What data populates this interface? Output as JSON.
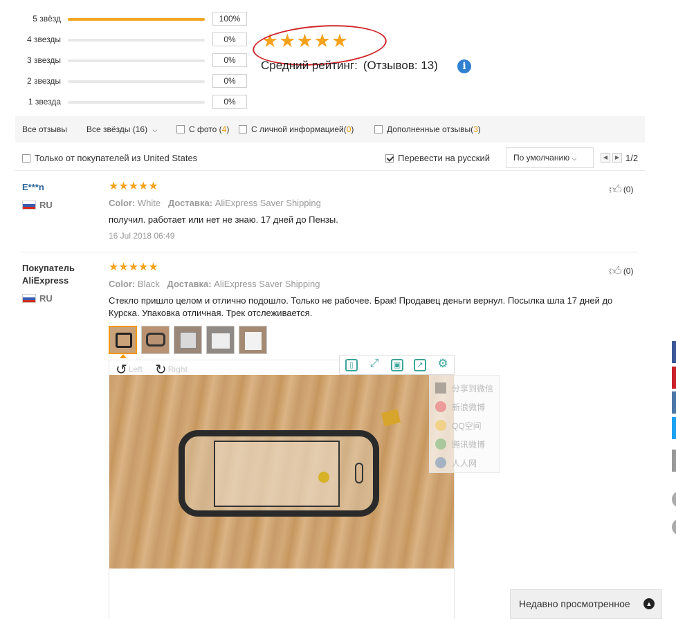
{
  "histogram": [
    {
      "label": "5 звёзд",
      "percent": "100%",
      "fill": 1.0
    },
    {
      "label": "4 звезды",
      "percent": "0%",
      "fill": 0
    },
    {
      "label": "3 звезды",
      "percent": "0%",
      "fill": 0
    },
    {
      "label": "2 звезды",
      "percent": "0%",
      "fill": 0
    },
    {
      "label": "1 звезда",
      "percent": "0%",
      "fill": 0
    }
  ],
  "summary": {
    "stars": "★★★★★",
    "avg_label": "Средний рейтинг:",
    "count_label": "(Отзывов: 13)",
    "info": "i"
  },
  "filters": {
    "all": "Все отзывы",
    "all_stars": "Все звёзды (16)",
    "with_photo": "С фото (",
    "with_photo_count": "4",
    "with_photo_close": ")",
    "with_info": "С личной информацией(",
    "with_info_count": "0",
    "with_info_close": ")",
    "supplemented": "Дополненные отзывы(",
    "supplemented_count": "3",
    "supplemented_close": ")",
    "only_from": "Только от покупателей из United States",
    "translate": "Перевести на русский",
    "sort": "По умолчанию",
    "page": "1/2"
  },
  "reviews": [
    {
      "name": "E***n",
      "country": "RU",
      "stars": "★★★★★",
      "color_label": "Color:",
      "color_value": "White",
      "ship_label": "Доставка:",
      "ship_value": "AliExpress Saver Shipping",
      "text": "получил. работает или нет не знаю. 17 дней до Пензы.",
      "date": "16 Jul 2018 06:49",
      "likes": "(0)"
    },
    {
      "name_line1": "Покупатель",
      "name_line2": "AliExpress",
      "country": "RU",
      "stars": "★★★★★",
      "color_label": "Color:",
      "color_value": "Black",
      "ship_label": "Доставка:",
      "ship_value": "AliExpress Saver Shipping",
      "text_line1": "Стекло пришло целом и отлично подошло. Только не рабочее. Брак! Продавец деньги вернул. Посылка шла 17 дней до",
      "text_line2": "Курска. Упаковка отличная. Трек отслеживается.",
      "likes": "(0)"
    }
  ],
  "viewer": {
    "rotate_left": "Left",
    "rotate_right": "Right",
    "share": [
      "分享到微信",
      "新浪微博",
      "QQ空间",
      "腾讯微博",
      "人人网"
    ]
  },
  "recent": "Недавно просмотренное",
  "colors": {
    "accent": "#f5a21b",
    "link": "#2a6496",
    "circle": "#d0262b"
  }
}
